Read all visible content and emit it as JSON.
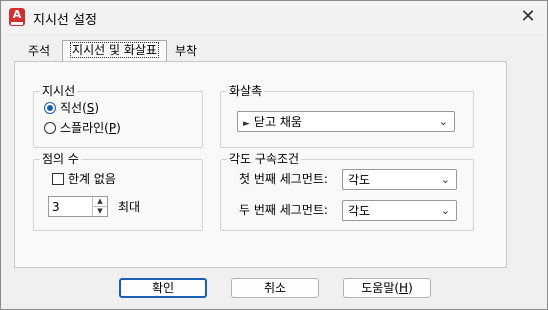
{
  "window": {
    "title": "지시선 설정",
    "app_icon_letter": "A"
  },
  "tabs": [
    {
      "label": "주석"
    },
    {
      "label": "지시선 및 화살표"
    },
    {
      "label": "부착"
    }
  ],
  "leader_group": {
    "title": "지시선",
    "options": [
      {
        "text": "직선(",
        "key": "S",
        "end": ")",
        "checked": true
      },
      {
        "text": "스플라인(",
        "key": "P",
        "end": ")",
        "checked": false
      }
    ]
  },
  "arrow_group": {
    "title": "화살촉",
    "combo_icon": "arrow-icon",
    "value": "닫고 채움"
  },
  "points_group": {
    "title": "점의 수",
    "no_limit_label": "한계 없음",
    "no_limit_checked": false,
    "value": "3",
    "max_label": "최대"
  },
  "constraint_group": {
    "title": "각도 구속조건",
    "first_label": "첫 번째 세그먼트:",
    "first_value": "각도",
    "second_label": "두 번째 세그먼트:",
    "second_value": "각도"
  },
  "buttons": {
    "ok": "확인",
    "cancel": "취소",
    "help_text": "도움말(",
    "help_key": "H",
    "help_end": ")"
  }
}
